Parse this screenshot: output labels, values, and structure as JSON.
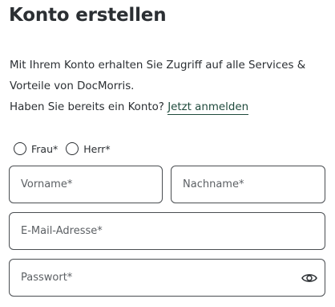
{
  "page": {
    "title": "Konto erstellen",
    "intro_line1": "Mit Ihrem Konto erhalten Sie Zugriff auf alle Services &",
    "intro_line2": "Vorteile von DocMorris.",
    "intro_line3_prefix": "Haben Sie bereits ein Konto?",
    "login_link": "Jetzt anmelden"
  },
  "salutation": {
    "options": [
      {
        "label": "Frau*",
        "selected": false
      },
      {
        "label": "Herr*",
        "selected": false
      }
    ]
  },
  "form": {
    "first_name": {
      "placeholder": "Vorname*",
      "value": ""
    },
    "last_name": {
      "placeholder": "Nachname*",
      "value": ""
    },
    "email": {
      "placeholder": "E-Mail-Adresse*",
      "value": ""
    },
    "password": {
      "placeholder": "Passwort*",
      "value": "",
      "toggle_icon": "eye-icon"
    }
  },
  "colors": {
    "link": "#1f4a3c",
    "text": "#2b2f33",
    "border": "#4a4e52"
  }
}
